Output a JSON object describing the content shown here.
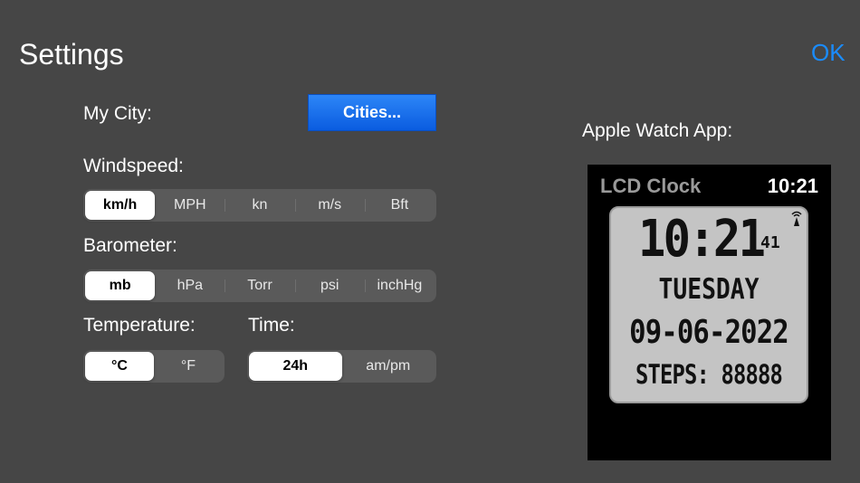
{
  "header": {
    "title": "Settings",
    "ok_label": "OK"
  },
  "city": {
    "label": "My City:",
    "button_label": "Cities..."
  },
  "windspeed": {
    "label": "Windspeed:",
    "options": [
      "km/h",
      "MPH",
      "kn",
      "m/s",
      "Bft"
    ],
    "selected": "km/h"
  },
  "barometer": {
    "label": "Barometer:",
    "options": [
      "mb",
      "hPa",
      "Torr",
      "psi",
      "inchHg"
    ],
    "selected": "mb"
  },
  "temperature": {
    "label": "Temperature:",
    "options": [
      "°C",
      "°F"
    ],
    "selected": "°C"
  },
  "time": {
    "label": "Time:",
    "options": [
      "24h",
      "am/pm"
    ],
    "selected": "24h"
  },
  "watch": {
    "label": "Apple Watch App:",
    "app_name": "LCD Clock",
    "clock": "10:21",
    "lcd_time": "10:21",
    "lcd_seconds": "41",
    "lcd_day": "TUESDAY",
    "lcd_date": "09-06-2022",
    "lcd_steps": "STEPS: 88888",
    "signal_icon": "antenna-signal-icon"
  },
  "colors": {
    "background": "#464646",
    "accent": "#1a8cff",
    "button": "#0a5ce0",
    "lcd": "#c4c4c4"
  }
}
